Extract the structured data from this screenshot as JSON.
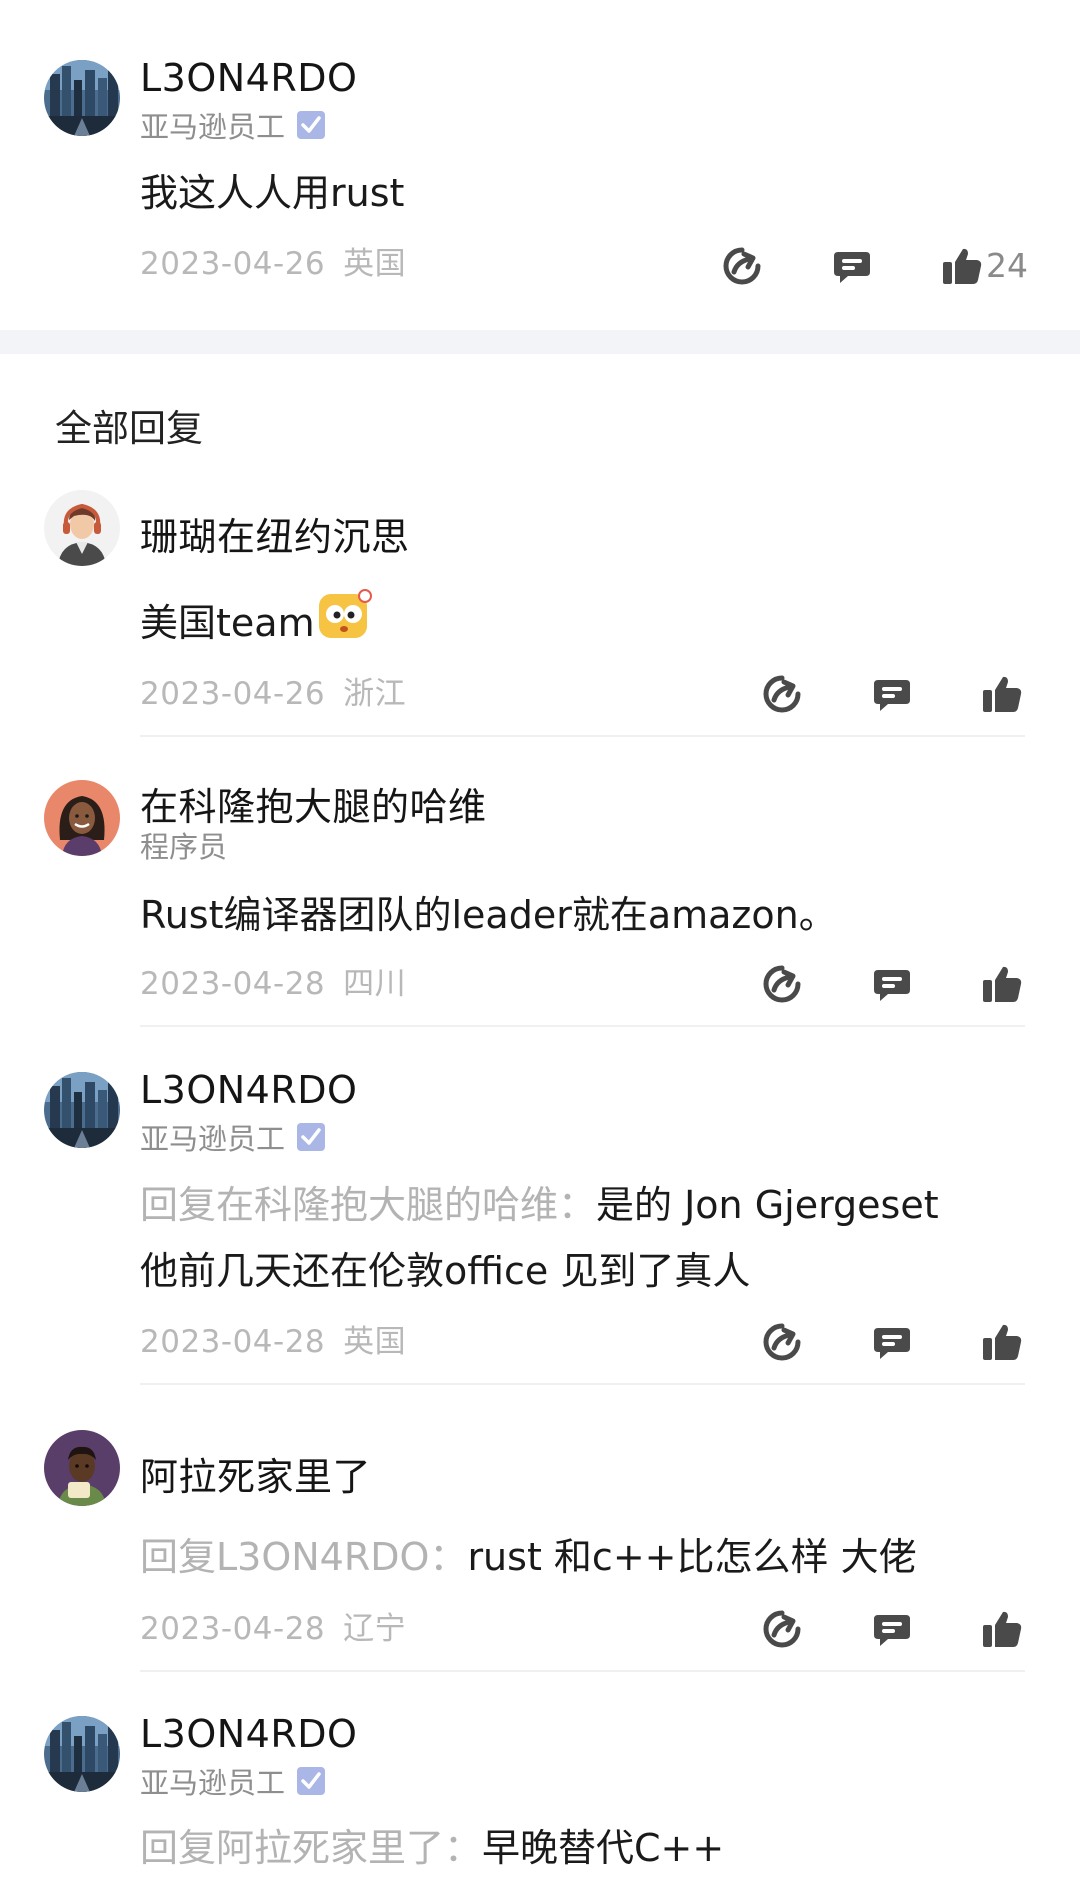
{
  "main_comment": {
    "user": "L3ON4RDO",
    "role": "亚马逊员工",
    "text": "我这人人用rust",
    "date": "2023-04-26",
    "location": "英国",
    "likes": "24"
  },
  "section_title": "全部回复",
  "replies": [
    {
      "user": "珊瑚在纽约沉思",
      "text": "美国team",
      "date": "2023-04-26",
      "location": "浙江"
    },
    {
      "user": "在科隆抱大腿的哈维",
      "role": "程序员",
      "text": "Rust编译器团队的leader就在amazon。",
      "date": "2023-04-28",
      "location": "四川"
    },
    {
      "user": "L3ON4RDO",
      "role": "亚马逊员工",
      "reply_prefix": "回复在科隆抱大腿的哈维：",
      "text_line1": "是的 Jon Gjergeset",
      "text_line2": "他前几天还在伦敦office 见到了真人",
      "date": "2023-04-28",
      "location": "英国"
    },
    {
      "user": "阿拉死家里了",
      "reply_prefix": "回复L3ON4RDO：",
      "text": "rust 和c++比怎么样 大佬",
      "date": "2023-04-28",
      "location": "辽宁"
    },
    {
      "user": "L3ON4RDO",
      "role": "亚马逊员工",
      "reply_prefix": "回复阿拉死家里了：",
      "text": "早晚替代C++"
    }
  ],
  "icons": {
    "share": "share-icon",
    "comment": "comment-icon",
    "like": "thumbs-up-icon",
    "verified": "verified-badge-icon"
  },
  "colors": {
    "verified_badge": "#a9b6e6",
    "icon": "#4a4a4a",
    "muted_text": "#b8b8b8"
  }
}
